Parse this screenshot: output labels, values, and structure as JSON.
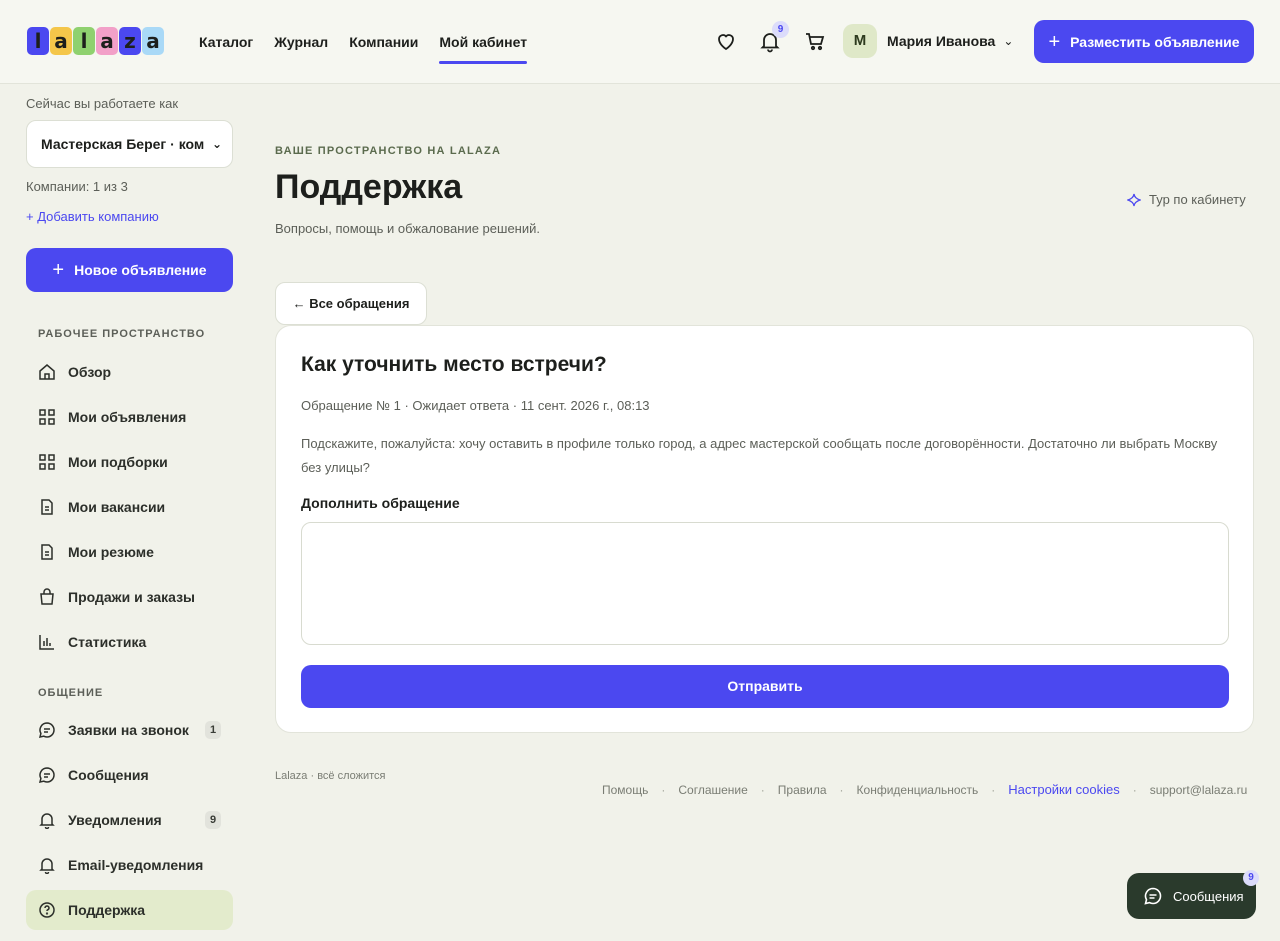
{
  "header": {
    "logo_letters": [
      {
        "char": "l",
        "color": "#4b48f0"
      },
      {
        "char": "a",
        "color": "#f4c64a"
      },
      {
        "char": "l",
        "color": "#8fd16f"
      },
      {
        "char": "a",
        "color": "#f2a0c8"
      },
      {
        "char": "z",
        "color": "#4b48f0"
      },
      {
        "char": "a",
        "color": "#a9d9f7"
      }
    ],
    "nav": [
      "Каталог",
      "Журнал",
      "Компании",
      "Мой кабинет"
    ],
    "nav_active": "Мой кабинет",
    "notifications_count": "9",
    "user_initial": "М",
    "user_name": "Мария Иванова",
    "post_button": "Разместить объявление"
  },
  "sidebar": {
    "working_as_label": "Сейчас вы работаете как",
    "company_selected": "Мастерская Берег · ком",
    "companies_count": "Компании: 1 из 3",
    "add_company": "+ Добавить компанию",
    "new_ad_button": "Новое объявление",
    "section_workspace": "РАБОЧЕЕ ПРОСТРАНСТВО",
    "workspace_items": [
      "Обзор",
      "Мои объявления",
      "Мои подборки",
      "Мои вакансии",
      "Мои резюме",
      "Продажи и заказы",
      "Статистика"
    ],
    "section_communication": "ОБЩЕНИЕ",
    "communication_items": [
      "Заявки на звонок",
      "Сообщения",
      "Уведомления",
      "Email-уведомления",
      "Поддержка"
    ],
    "call_requests_count": "1",
    "notifications_count": "9",
    "active_item": "Поддержка"
  },
  "main": {
    "eyebrow": "ВАШЕ ПРОСТРАНСТВО НА LALAZA",
    "title": "Поддержка",
    "subtitle": "Вопросы, помощь и обжалование решений.",
    "tour_link": "Тур по кабинету",
    "back_button": "← Все обращения",
    "ticket": {
      "title": "Как уточнить место встречи?",
      "meta": "Обращение № 1 · Ожидает ответа · 11 сент. 2026 г., 08:13",
      "body": "Подскажите, пожалуйста: хочу оставить в профиле только город, а адрес мастерской сообщать после договорённости. Достаточно ли выбрать Москву без улицы?",
      "add_label": "Дополнить обращение",
      "reply_value": "",
      "send_button": "Отправить"
    }
  },
  "footer": {
    "tagline": "Lalaza · всё сложится",
    "links": [
      "Помощь",
      "Соглашение",
      "Правила",
      "Конфиденциальность"
    ],
    "cookie_link": "Настройки cookies",
    "email": "support@lalaza.ru"
  },
  "chat_widget": {
    "label": "Сообщения",
    "count": "9"
  },
  "colors": {
    "accent": "#4b48f0",
    "background": "#f1f2ea",
    "active_item_bg": "#e3ebcc",
    "chat_widget_bg": "#2a3a2c"
  }
}
